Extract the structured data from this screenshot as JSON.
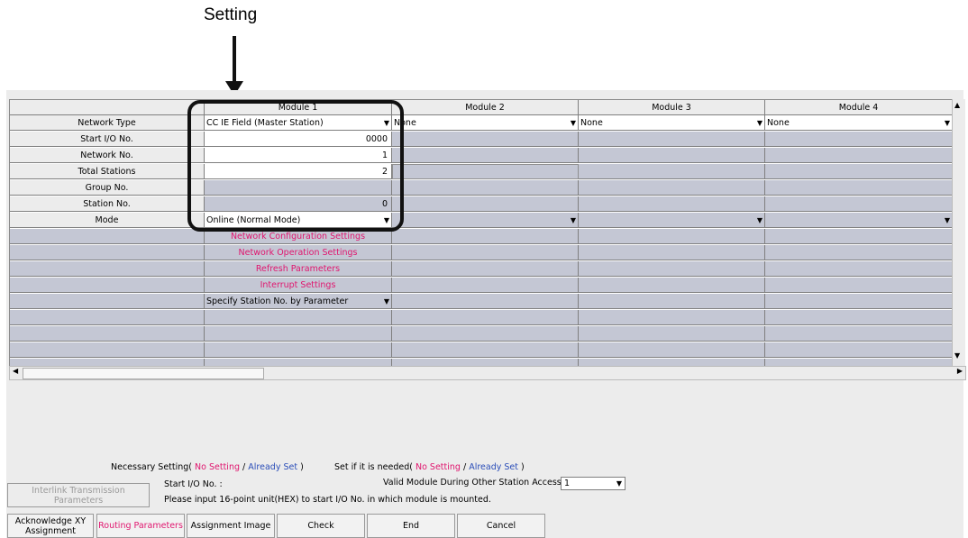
{
  "callout": {
    "label": "Setting"
  },
  "grid": {
    "headers": [
      "Module 1",
      "Module 2",
      "Module 3",
      "Module 4"
    ],
    "rows": {
      "network_type": {
        "label": "Network Type",
        "values": [
          "CC IE Field (Master Station)",
          "None",
          "None",
          "None"
        ]
      },
      "start_io": {
        "label": "Start I/O No.",
        "values": [
          "0000"
        ]
      },
      "network_no": {
        "label": "Network No.",
        "values": [
          "1"
        ]
      },
      "total_stations": {
        "label": "Total Stations",
        "values": [
          "2"
        ]
      },
      "group_no": {
        "label": "Group No."
      },
      "station_no": {
        "label": "Station No.",
        "values": [
          "0"
        ]
      },
      "mode": {
        "label": "Mode",
        "values": [
          "Online (Normal Mode)"
        ]
      }
    },
    "links": {
      "network_configuration": "Network Configuration Settings",
      "network_operation": "Network Operation Settings",
      "refresh_parameters": "Refresh Parameters",
      "interrupt_settings": "Interrupt Settings"
    },
    "station_spec": "Specify Station No. by Parameter"
  },
  "legend": {
    "necessary": "Necessary Setting(",
    "no_setting_1": "No Setting",
    "slash_1": "/",
    "already_set_1": "Already Set",
    "close_1": ")",
    "if_needed": "Set if it is needed(",
    "no_setting_2": "No Setting",
    "slash_2": "/",
    "already_set_2": "Already Set",
    "close_2": ")"
  },
  "info": {
    "start_io_label": "Start I/O No. :",
    "valid_module_label": "Valid Module During Other Station Access",
    "valid_module_value": "1",
    "hint": "Please input 16-point unit(HEX) to start I/O No. in which module is mounted."
  },
  "buttons": {
    "interlink": "Interlink Transmission Parameters",
    "acknowledge": "Acknowledge XY Assignment",
    "routing": "Routing Parameters",
    "assignment_image": "Assignment Image",
    "check": "Check",
    "end": "End",
    "cancel": "Cancel"
  },
  "colors": {
    "pink": "#e0156e",
    "blue": "#2a4db8",
    "grid_gray": "#c4c7d4"
  }
}
